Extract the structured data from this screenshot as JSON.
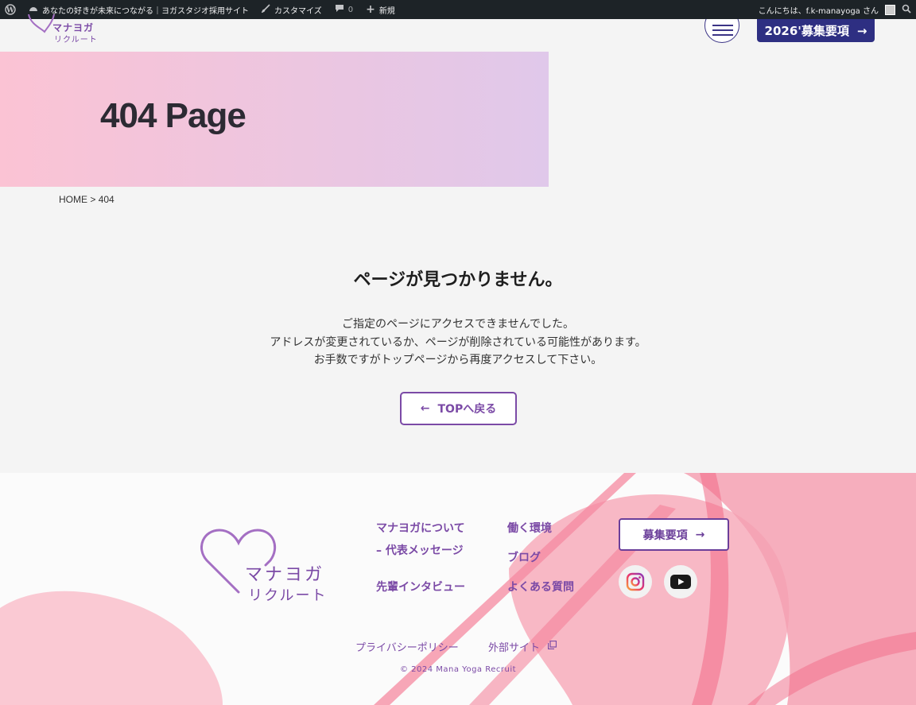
{
  "adminbar": {
    "site_name": "あなたの好きが未来につながる｜ヨガスタジオ採用サイト",
    "customize": "カスタマイズ",
    "comments_count": "0",
    "new": "新規",
    "greeting": "こんにちは、f.k-manayoga さん"
  },
  "header": {
    "logo_line1": "マナヨガ",
    "logo_line2": "リクルート",
    "recruit_button": "2026'募集要項"
  },
  "hero": {
    "title": "404 Page"
  },
  "breadcrumb": {
    "home": "HOME",
    "separator": ">",
    "current": "404"
  },
  "main": {
    "title": "ページが見つかりません。",
    "lines": [
      "ご指定のページにアクセスできませんでした。",
      "アドレスが変更されているか、ページが削除されている可能性があります。",
      "お手数ですがトップページから再度アクセスして下さい。"
    ],
    "back_button": "TOPへ戻る"
  },
  "footer": {
    "logo_line1": "マナヨガ",
    "logo_line2": "リクルート",
    "nav": {
      "about": "マナヨガについて",
      "message": "– 代表メッセージ",
      "interview": "先輩インタビュー",
      "environment": "働く環境",
      "blog": "ブログ",
      "faq": "よくある質問"
    },
    "recruit_button": "募集要項",
    "privacy": "プライバシーポリシー",
    "external": "外部サイト",
    "copyright": "© 2024 Mana Yoga Recruit"
  },
  "colors": {
    "accent": "#7b4aa6",
    "navy": "#2e2f82",
    "hero_start": "#fbc3d4",
    "hero_end": "#e0c8ea",
    "footer_pink": "#f7a2b4"
  }
}
